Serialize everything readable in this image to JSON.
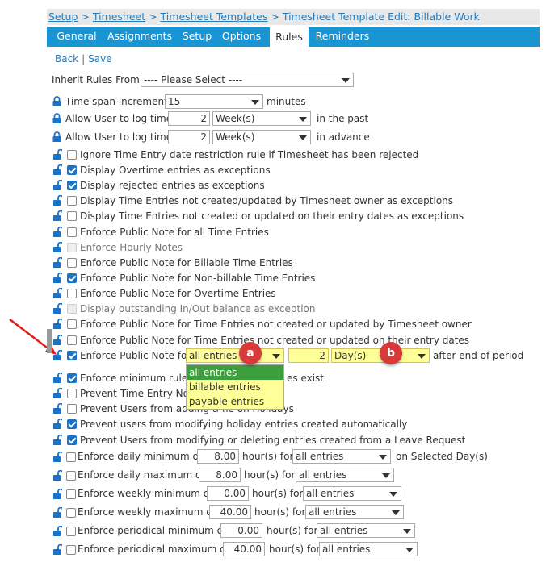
{
  "breadcrumb": {
    "setup": "Setup",
    "sep1": " > ",
    "timesheet": "Timesheet",
    "sep2": " > ",
    "templates": "Timesheet Templates",
    "sep3": " > ",
    "current": "Timesheet Template Edit: Billable Work"
  },
  "tabs": [
    "General",
    "Assignments",
    "Setup",
    "Options",
    "Rules",
    "Reminders"
  ],
  "active_tab": "Rules",
  "nav": {
    "back": "Back",
    "separator": "|",
    "save": "Save"
  },
  "inherit": {
    "label": "Inherit Rules From:",
    "value": "---- Please Select ----"
  },
  "time_span": {
    "label": "Time span increment",
    "value": "15",
    "unit": "minutes"
  },
  "log_past": {
    "label": "Allow User to log time",
    "count": "2",
    "period": "Week(s)",
    "suffix": "in the past"
  },
  "log_advance": {
    "label": "Allow User to log time",
    "count": "2",
    "period": "Week(s)",
    "suffix": "in advance"
  },
  "rules": [
    {
      "label": "Ignore Time Entry date restriction rule if Timesheet has been rejected",
      "checked": false
    },
    {
      "label": "Display Overtime entries as exceptions",
      "checked": true
    },
    {
      "label": "Display rejected entries as exceptions",
      "checked": true
    },
    {
      "label": "Display Time Entries not created/updated by Timesheet owner as exceptions",
      "checked": false
    },
    {
      "label": "Display Time Entries not created or updated on their entry dates as exceptions",
      "checked": false
    },
    {
      "label": "Enforce Public Note for all Time Entries",
      "checked": false
    },
    {
      "label": "Enforce Hourly Notes",
      "checked": false,
      "disabled": true
    },
    {
      "label": "Enforce Public Note for Billable Time Entries",
      "checked": false
    },
    {
      "label": "Enforce Public Note for Non-billable Time Entries",
      "checked": true
    },
    {
      "label": "Enforce Public Note for Overtime Entries",
      "checked": false
    },
    {
      "label": "Display outstanding In/Out balance as exception",
      "checked": false,
      "disabled": true
    },
    {
      "label": "Enforce Public Note for Time Entries not created or updated by Timesheet owner",
      "checked": false
    },
    {
      "label": "Enforce Public Note for Time Entries not created or updated on their entry dates",
      "checked": false
    }
  ],
  "period_rule": {
    "label": "Enforce Public Note for",
    "checked": true,
    "entries_value": "all entries",
    "count": "2",
    "period": "Day(s)",
    "suffix": "after end of period"
  },
  "dropdown_options": [
    "all entries",
    "billable entries",
    "payable entries"
  ],
  "badges": {
    "a": "a",
    "b": "b"
  },
  "rules2": [
    {
      "label": "Enforce minimum rules",
      "tail": "es exist",
      "checked": true
    },
    {
      "label": "Prevent Time Entry Note",
      "tail": "",
      "checked": false
    },
    {
      "label": "Prevent Users from adding time on Holidays",
      "tail": "",
      "checked": false
    },
    {
      "label": "Prevent users from modifying holiday entries created automatically",
      "checked": true
    },
    {
      "label": "Prevent Users from modifying or deleting entries created from a Leave Request",
      "checked": true
    }
  ],
  "hour_rules": [
    {
      "label": "Enforce daily minimum of",
      "hours": "8.00",
      "unit": "hour(s) for",
      "entries": "all entries",
      "suffix": "on Selected Day(s)"
    },
    {
      "label": "Enforce daily maximum of",
      "hours": "8.00",
      "unit": "hour(s) for",
      "entries": "all entries",
      "suffix": ""
    },
    {
      "label": "Enforce weekly minimum of",
      "hours": "0.00",
      "unit": "hour(s) for",
      "entries": "all entries",
      "suffix": ""
    },
    {
      "label": "Enforce weekly maximum of",
      "hours": "40.00",
      "unit": "hour(s) for",
      "entries": "all entries",
      "suffix": ""
    },
    {
      "label": "Enforce periodical minimum of",
      "hours": "0.00",
      "unit": "hour(s) for",
      "entries": "all entries",
      "suffix": ""
    },
    {
      "label": "Enforce periodical maximum of",
      "hours": "40.00",
      "unit": "hour(s) for",
      "entries": "all entries",
      "suffix": ""
    }
  ],
  "colors": {
    "tab_bar": "#1a95d3",
    "link": "#2a7ab5",
    "lock": "#1a73c9",
    "highlight": "#ffff99",
    "badge": "#d83a3a",
    "arrow": "#e02020"
  }
}
